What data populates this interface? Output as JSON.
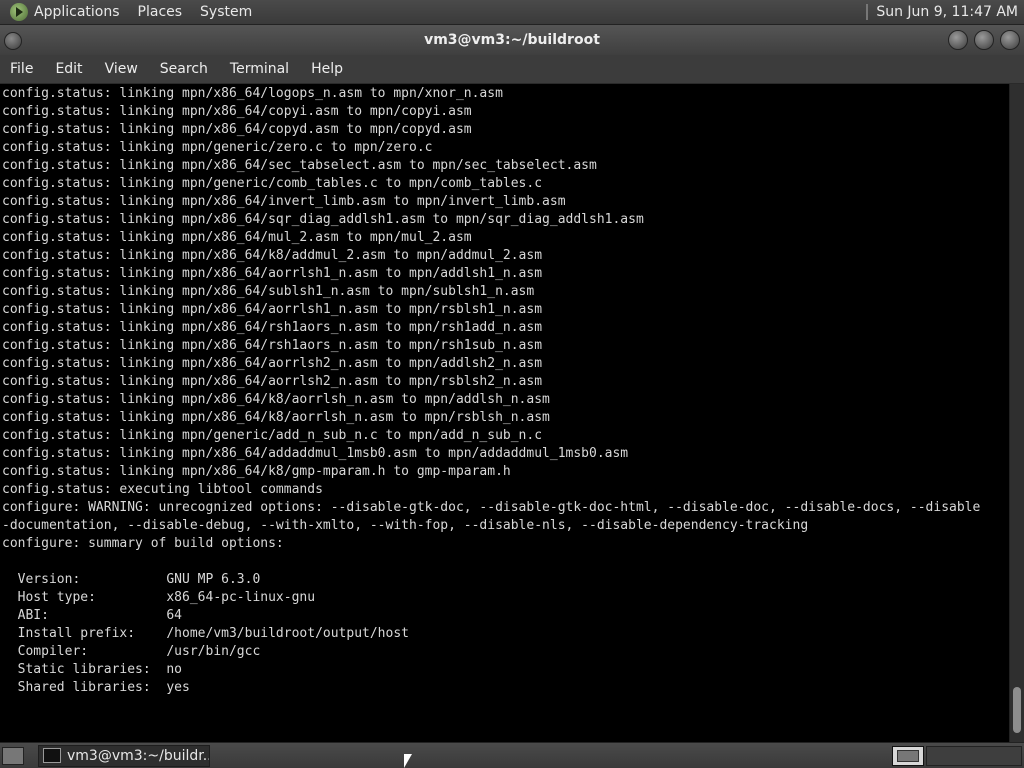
{
  "panel": {
    "menus": [
      "Applications",
      "Places",
      "System"
    ],
    "clock": "Sun Jun  9, 11:47 AM"
  },
  "window": {
    "title": "vm3@vm3:~/buildroot"
  },
  "menubar": [
    "File",
    "Edit",
    "View",
    "Search",
    "Terminal",
    "Help"
  ],
  "terminal": {
    "lines": [
      "config.status: linking mpn/x86_64/logops_n.asm to mpn/xnor_n.asm",
      "config.status: linking mpn/x86_64/copyi.asm to mpn/copyi.asm",
      "config.status: linking mpn/x86_64/copyd.asm to mpn/copyd.asm",
      "config.status: linking mpn/generic/zero.c to mpn/zero.c",
      "config.status: linking mpn/x86_64/sec_tabselect.asm to mpn/sec_tabselect.asm",
      "config.status: linking mpn/generic/comb_tables.c to mpn/comb_tables.c",
      "config.status: linking mpn/x86_64/invert_limb.asm to mpn/invert_limb.asm",
      "config.status: linking mpn/x86_64/sqr_diag_addlsh1.asm to mpn/sqr_diag_addlsh1.asm",
      "config.status: linking mpn/x86_64/mul_2.asm to mpn/mul_2.asm",
      "config.status: linking mpn/x86_64/k8/addmul_2.asm to mpn/addmul_2.asm",
      "config.status: linking mpn/x86_64/aorrlsh1_n.asm to mpn/addlsh1_n.asm",
      "config.status: linking mpn/x86_64/sublsh1_n.asm to mpn/sublsh1_n.asm",
      "config.status: linking mpn/x86_64/aorrlsh1_n.asm to mpn/rsblsh1_n.asm",
      "config.status: linking mpn/x86_64/rsh1aors_n.asm to mpn/rsh1add_n.asm",
      "config.status: linking mpn/x86_64/rsh1aors_n.asm to mpn/rsh1sub_n.asm",
      "config.status: linking mpn/x86_64/aorrlsh2_n.asm to mpn/addlsh2_n.asm",
      "config.status: linking mpn/x86_64/aorrlsh2_n.asm to mpn/rsblsh2_n.asm",
      "config.status: linking mpn/x86_64/k8/aorrlsh_n.asm to mpn/addlsh_n.asm",
      "config.status: linking mpn/x86_64/k8/aorrlsh_n.asm to mpn/rsblsh_n.asm",
      "config.status: linking mpn/generic/add_n_sub_n.c to mpn/add_n_sub_n.c",
      "config.status: linking mpn/x86_64/addaddmul_1msb0.asm to mpn/addaddmul_1msb0.asm",
      "config.status: linking mpn/x86_64/k8/gmp-mparam.h to gmp-mparam.h",
      "config.status: executing libtool commands",
      "configure: WARNING: unrecognized options: --disable-gtk-doc, --disable-gtk-doc-html, --disable-doc, --disable-docs, --disable",
      "-documentation, --disable-debug, --with-xmlto, --with-fop, --disable-nls, --disable-dependency-tracking",
      "configure: summary of build options:",
      "",
      "  Version:           GNU MP 6.3.0",
      "  Host type:         x86_64-pc-linux-gnu",
      "  ABI:               64",
      "  Install prefix:    /home/vm3/buildroot/output/host",
      "  Compiler:          /usr/bin/gcc",
      "  Static libraries:  no",
      "  Shared libraries:  yes"
    ]
  },
  "taskbar": {
    "task_label": "vm3@vm3:~/buildr..."
  }
}
